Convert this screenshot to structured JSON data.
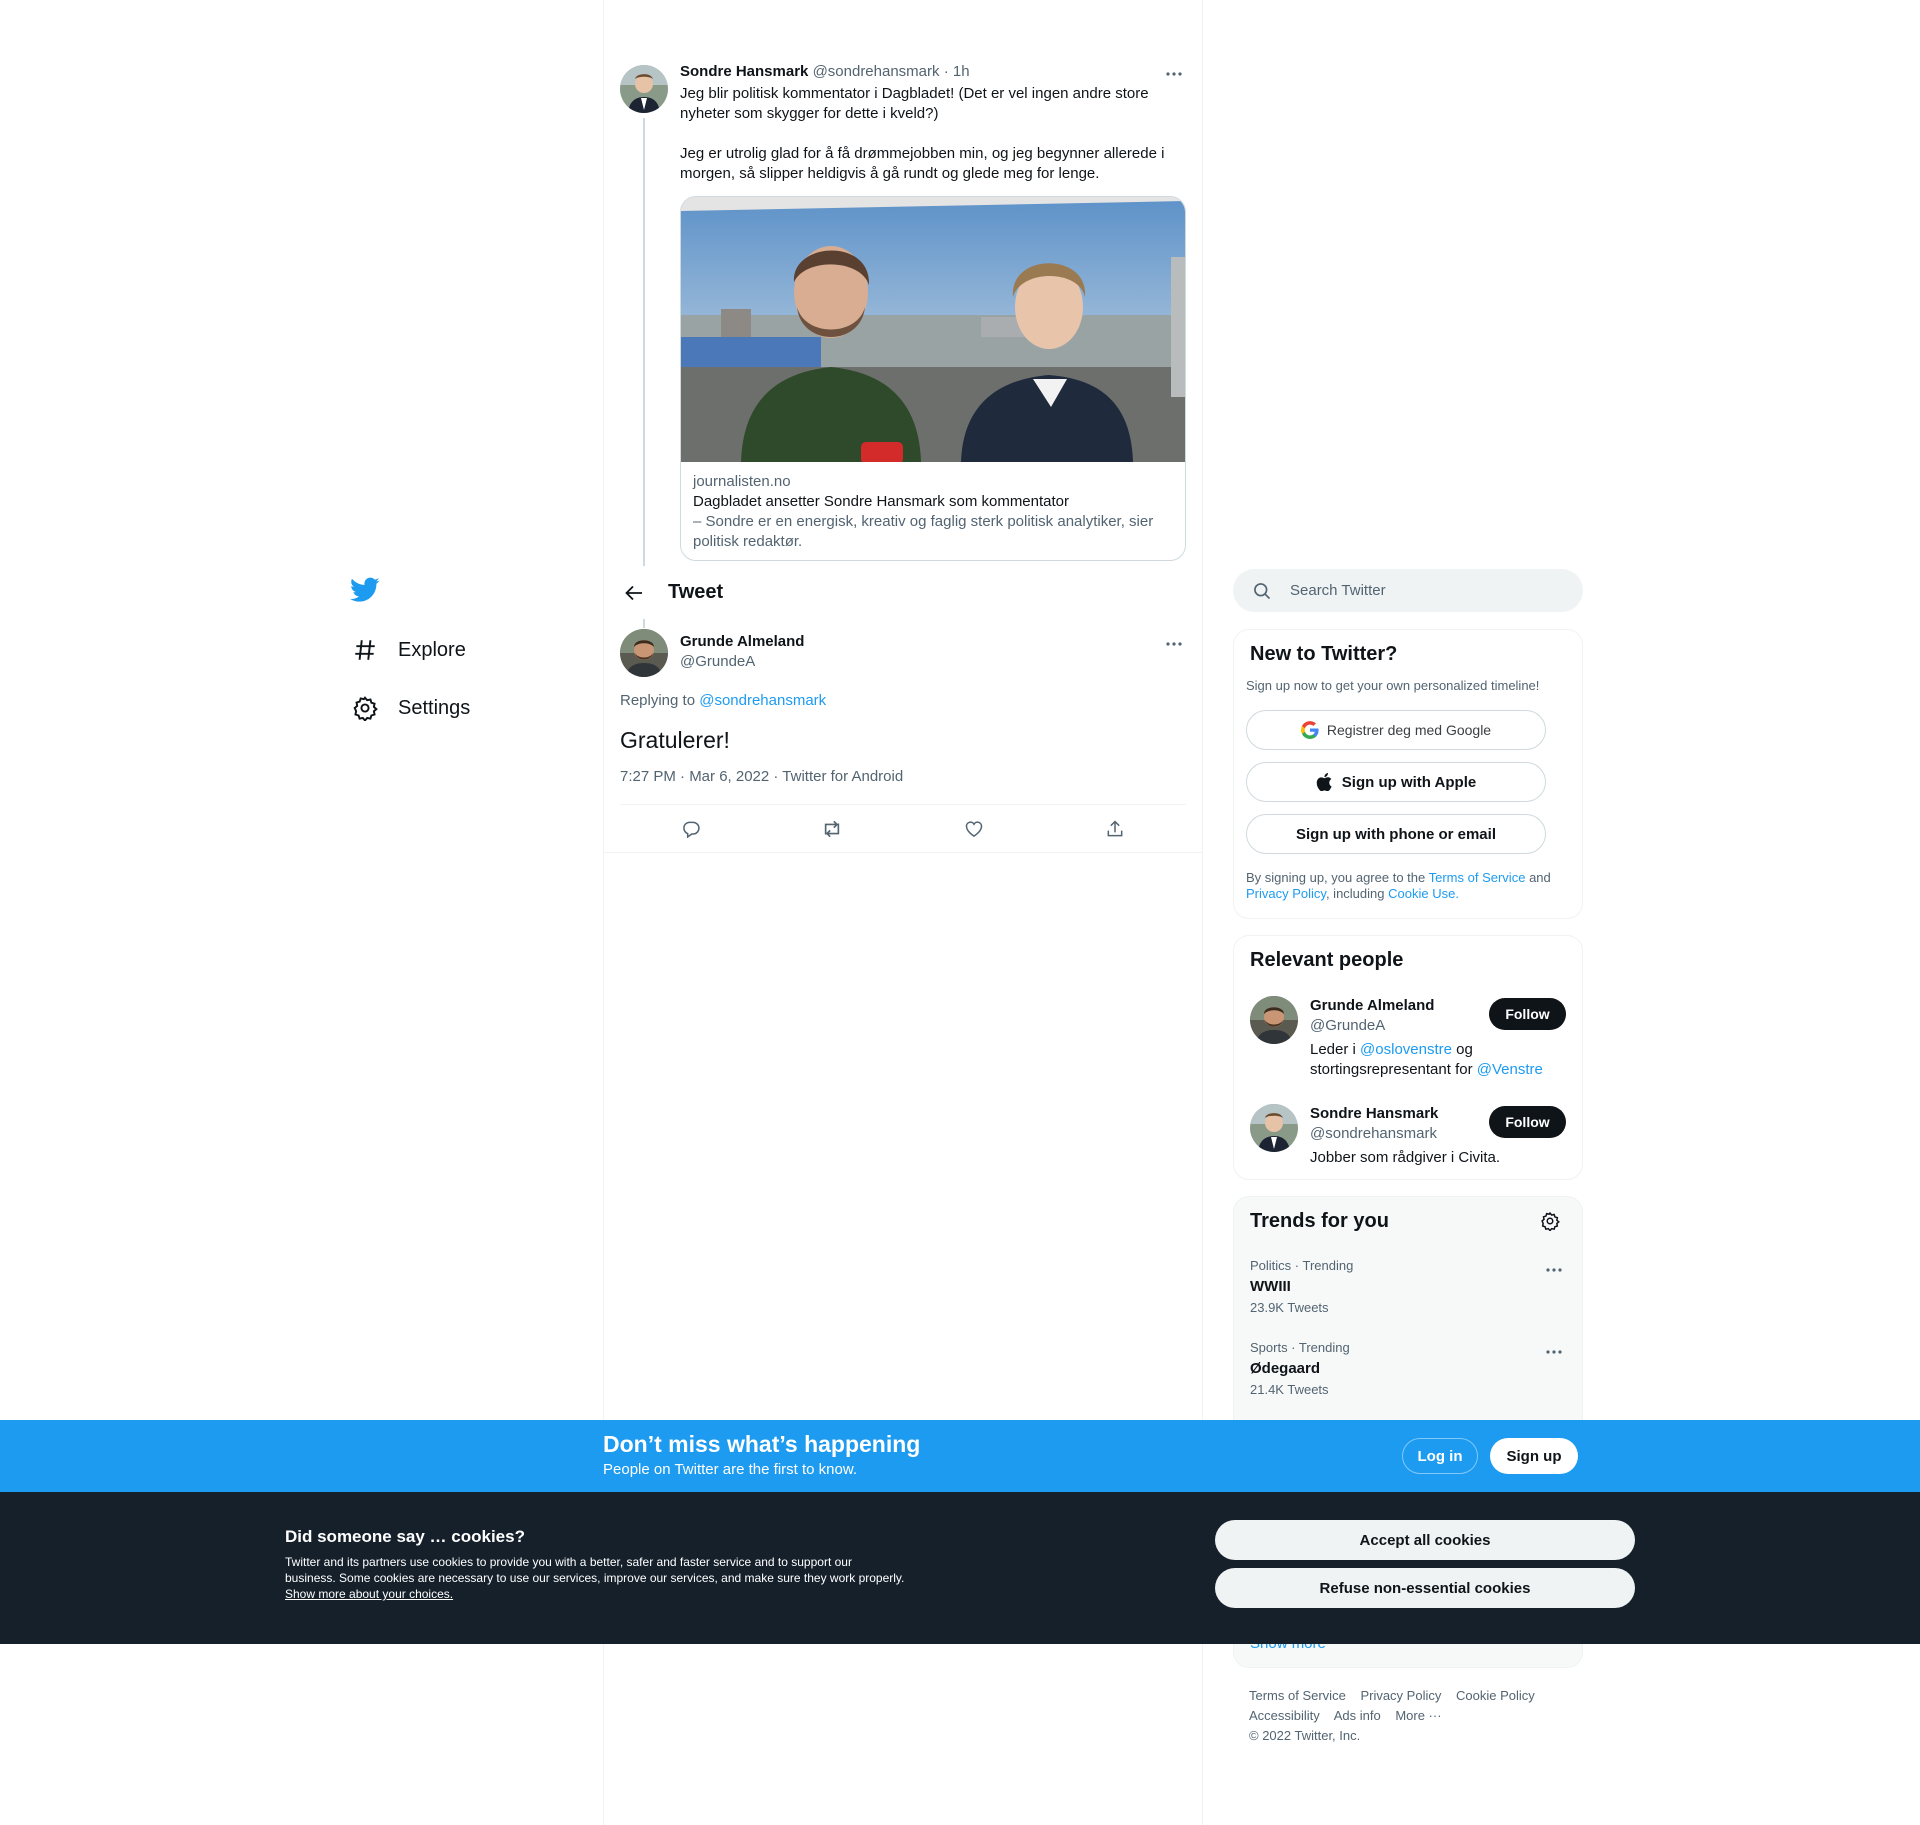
{
  "brand": {
    "accent": "#1d9bf0",
    "dark": "#0f1419",
    "muted": "#536471"
  },
  "nav": {
    "items": [
      {
        "label": "Explore",
        "icon": "hashtag-icon"
      },
      {
        "label": "Settings",
        "icon": "gear-icon"
      }
    ]
  },
  "parent_tweet": {
    "name": "Sondre Hansmark",
    "handle": "@sondrehansmark",
    "time": "· 1h",
    "paragraph1": "Jeg blir politisk kommentator i Dagbladet! (Det er vel ingen andre store nyheter som skygger for dette i kveld?)",
    "paragraph2": "Jeg er utrolig glad for å få drømmejobben min, og jeg begynner allerede i morgen, så slipper heldigvis å gå rundt og glede meg for lenge.",
    "card": {
      "domain": "journalisten.no",
      "title": "Dagbladet ansetter Sondre Hansmark som kommentator",
      "description": "– Sondre er en energisk, kreativ og faglig sterk politisk analytiker, sier politisk redaktør."
    }
  },
  "header": {
    "title": "Tweet"
  },
  "main_tweet": {
    "name": "Grunde Almeland",
    "handle": "@GrundeA",
    "replying_prefix": "Replying to",
    "replying_to": "@sondrehansmark",
    "text": "Gratulerer!",
    "timestamp": "7:27 PM · Mar 6, 2022 · Twitter for Android"
  },
  "search": {
    "placeholder": "Search Twitter"
  },
  "new_to_twitter": {
    "title": "New to Twitter?",
    "subtitle": "Sign up now to get your own personalized timeline!",
    "google_label": "Registrer deg med Google",
    "apple_label": "Sign up with Apple",
    "phone_label": "Sign up with phone or email",
    "legal_1": "By signing up, you agree to the",
    "terms": "Terms of Service",
    "legal_2": "and",
    "privacy": "Privacy Policy",
    "legal_3": ", including",
    "cookie_use": "Cookie Use."
  },
  "relevant_people": {
    "title": "Relevant people",
    "people": [
      {
        "name": "Grunde Almeland",
        "handle": "@GrundeA",
        "bio_1": "Leder i",
        "bio_link_1": "@oslovenstre",
        "bio_2": "og stortingsrepresentant for",
        "bio_link_2": "@Venstre",
        "follow_label": "Follow"
      },
      {
        "name": "Sondre Hansmark",
        "handle": "@sondrehansmark",
        "bio": "Jobber som rådgiver i Civita.",
        "follow_label": "Follow"
      }
    ]
  },
  "trends": {
    "title": "Trends for you",
    "items": [
      {
        "category": "Politics · Trending",
        "name": "WWIII",
        "count": "23.9K Tweets"
      },
      {
        "category": "Sports · Trending",
        "name": "Ødegaard",
        "count": "21.4K Tweets"
      }
    ],
    "show_more": "Show more"
  },
  "footer": {
    "links": [
      "Terms of Service",
      "Privacy Policy",
      "Cookie Policy",
      "Accessibility",
      "Ads info",
      "More ···"
    ],
    "copyright": "© 2022 Twitter, Inc."
  },
  "banner": {
    "title": "Don’t miss what’s happening",
    "subtitle": "People on Twitter are the first to know.",
    "login_label": "Log in",
    "signup_label": "Sign up"
  },
  "cookies": {
    "title": "Did someone say … cookies?",
    "text": "Twitter and its partners use cookies to provide you with a better, safer and faster service and to support our business. Some cookies are necessary to use our services, improve our services, and make sure they work properly.",
    "link": "Show more about your choices.",
    "accept_label": "Accept all cookies",
    "refuse_label": "Refuse non-essential cookies"
  }
}
